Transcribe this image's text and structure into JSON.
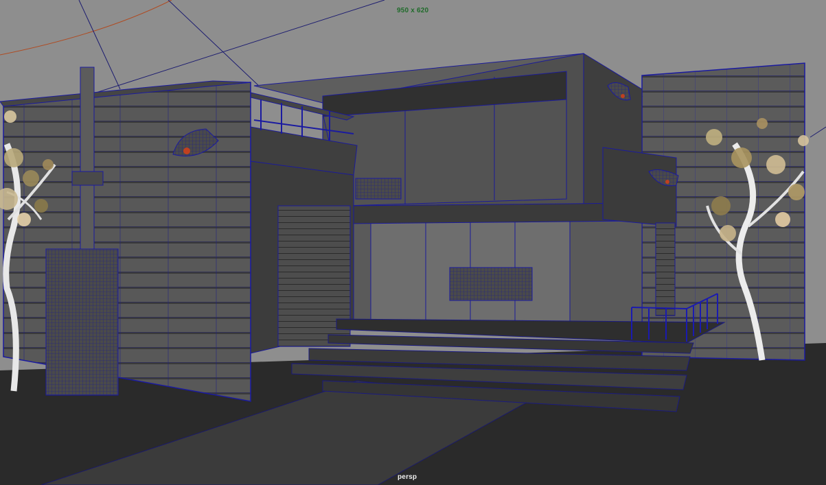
{
  "viewport": {
    "resolution_gate_label": "950 x 620",
    "camera_name": "persp",
    "colors": {
      "background": "#8e8e8e",
      "wireframe": "#1a1a9a",
      "ground": "#2a2a2a",
      "resolution_label": "#1f6b2a",
      "camera_label": "#f0f0f0"
    }
  }
}
